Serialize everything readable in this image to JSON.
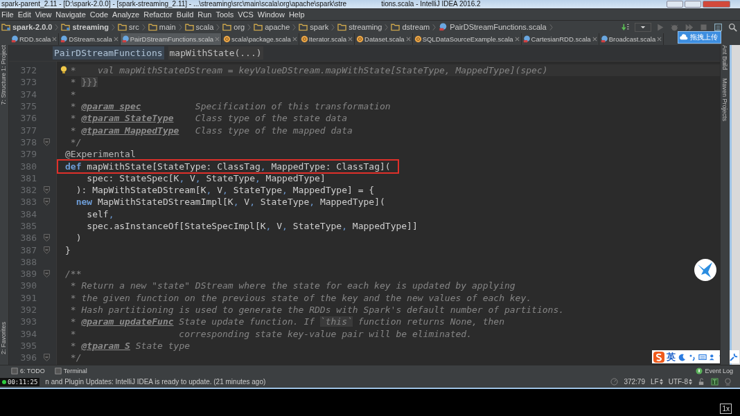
{
  "window": {
    "title_left": "spark-parent_2.11 - [D:\\spark-2.0.0] - [spark-streaming_2.11] - ...\\streaming\\src\\main\\scala\\org\\apache\\spark\\stre",
    "title_right": "tions.scala - IntelliJ IDEA 2016.2"
  },
  "menu": [
    "File",
    "Edit",
    "View",
    "Navigate",
    "Code",
    "Analyze",
    "Refactor",
    "Build",
    "Run",
    "Tools",
    "VCS",
    "Window",
    "Help"
  ],
  "breadcrumbs": [
    {
      "label": "spark-2.0.0",
      "kind": "module"
    },
    {
      "label": "streaming",
      "kind": "module"
    },
    {
      "label": "src",
      "kind": "folder"
    },
    {
      "label": "main",
      "kind": "folder"
    },
    {
      "label": "scala",
      "kind": "folder"
    },
    {
      "label": "org",
      "kind": "folder"
    },
    {
      "label": "apache",
      "kind": "folder"
    },
    {
      "label": "spark",
      "kind": "folder"
    },
    {
      "label": "streaming",
      "kind": "folder"
    },
    {
      "label": "dstream",
      "kind": "folder"
    },
    {
      "label": "PairDStreamFunctions.scala",
      "kind": "file"
    }
  ],
  "tabs": [
    {
      "label": "RDD.scala",
      "kind": "class",
      "selected": false
    },
    {
      "label": "DStream.scala",
      "kind": "class",
      "selected": false
    },
    {
      "label": "PairDStreamFunctions.scala",
      "kind": "class",
      "selected": true
    },
    {
      "label": "scala\\package.scala",
      "kind": "object",
      "selected": false
    },
    {
      "label": "Iterator.scala",
      "kind": "object",
      "selected": false
    },
    {
      "label": "Dataset.scala",
      "kind": "object",
      "selected": false
    },
    {
      "label": "SQLDataSourceExample.scala",
      "kind": "object",
      "selected": false
    },
    {
      "label": "CartesianRDD.scala",
      "kind": "class",
      "selected": false
    },
    {
      "label": "Broadcast.scala",
      "kind": "class",
      "selected": false
    }
  ],
  "editor_header": {
    "class_name": "PairDStreamFunctions",
    "method": "mapWithState(...)"
  },
  "lines": [
    {
      "number": "372",
      "fold": false,
      "current": true,
      "bulb": true,
      "boxed": false,
      "tokens": [
        {
          "kind": "comment",
          "text": " *    val mapWithStateDStream = keyValueDStream.mapWithState[StateType, MappedType](spec)"
        }
      ]
    },
    {
      "number": "373",
      "fold": false,
      "current": false,
      "bulb": false,
      "boxed": false,
      "tokens": [
        {
          "kind": "comment",
          "text": " * "
        },
        {
          "kind": "match",
          "text": "}}}"
        }
      ]
    },
    {
      "number": "374",
      "fold": false,
      "current": false,
      "bulb": false,
      "boxed": false,
      "tokens": [
        {
          "kind": "comment",
          "text": " *"
        }
      ]
    },
    {
      "number": "375",
      "fold": false,
      "current": false,
      "bulb": false,
      "boxed": false,
      "tokens": [
        {
          "kind": "comment",
          "text": " * "
        },
        {
          "kind": "tag",
          "text": "@param spec"
        },
        {
          "kind": "comment",
          "text": "          Specification of this transformation"
        }
      ]
    },
    {
      "number": "376",
      "fold": false,
      "current": false,
      "bulb": false,
      "boxed": false,
      "tokens": [
        {
          "kind": "comment",
          "text": " * "
        },
        {
          "kind": "tag",
          "text": "@tparam StateType"
        },
        {
          "kind": "comment",
          "text": "    Class type of the state data"
        }
      ]
    },
    {
      "number": "377",
      "fold": false,
      "current": false,
      "bulb": false,
      "boxed": false,
      "tokens": [
        {
          "kind": "comment",
          "text": " * "
        },
        {
          "kind": "tag",
          "text": "@tparam MappedType"
        },
        {
          "kind": "comment",
          "text": "   Class type of the mapped data"
        }
      ]
    },
    {
      "number": "378",
      "fold": true,
      "current": false,
      "bulb": false,
      "boxed": false,
      "tokens": [
        {
          "kind": "comment",
          "text": " */"
        }
      ]
    },
    {
      "number": "379",
      "fold": false,
      "current": false,
      "bulb": false,
      "boxed": false,
      "tokens": [
        {
          "kind": "annotation",
          "text": "@Experimental"
        }
      ]
    },
    {
      "number": "380",
      "fold": false,
      "current": false,
      "bulb": false,
      "boxed": true,
      "tokens": [
        {
          "kind": "keyword",
          "text": "def"
        },
        {
          "kind": "plain",
          "text": " mapWithState[StateType: ClassTag"
        },
        {
          "kind": "punct",
          "text": ","
        },
        {
          "kind": "plain",
          "text": " MappedType: ClassTag]("
        }
      ]
    },
    {
      "number": "381",
      "fold": false,
      "current": false,
      "bulb": false,
      "boxed": false,
      "tokens": [
        {
          "kind": "plain",
          "text": "    spec: StateSpec[K"
        },
        {
          "kind": "punct",
          "text": ","
        },
        {
          "kind": "plain",
          "text": " V"
        },
        {
          "kind": "punct",
          "text": ","
        },
        {
          "kind": "plain",
          "text": " StateType"
        },
        {
          "kind": "punct",
          "text": ","
        },
        {
          "kind": "plain",
          "text": " MappedType]"
        }
      ]
    },
    {
      "number": "382",
      "fold": true,
      "current": false,
      "bulb": false,
      "boxed": false,
      "tokens": [
        {
          "kind": "plain",
          "text": "  ): MapWithStateDStream[K"
        },
        {
          "kind": "punct",
          "text": ","
        },
        {
          "kind": "plain",
          "text": " V"
        },
        {
          "kind": "punct",
          "text": ","
        },
        {
          "kind": "plain",
          "text": " StateType"
        },
        {
          "kind": "punct",
          "text": ","
        },
        {
          "kind": "plain",
          "text": " MappedType] = {"
        }
      ]
    },
    {
      "number": "383",
      "fold": true,
      "current": false,
      "bulb": false,
      "boxed": false,
      "tokens": [
        {
          "kind": "keyword",
          "text": "  new"
        },
        {
          "kind": "plain",
          "text": " MapWithStateDStreamImpl[K"
        },
        {
          "kind": "punct",
          "text": ","
        },
        {
          "kind": "plain",
          "text": " V"
        },
        {
          "kind": "punct",
          "text": ","
        },
        {
          "kind": "plain",
          "text": " StateType"
        },
        {
          "kind": "punct",
          "text": ","
        },
        {
          "kind": "plain",
          "text": " MappedType]("
        }
      ]
    },
    {
      "number": "384",
      "fold": false,
      "current": false,
      "bulb": false,
      "boxed": false,
      "tokens": [
        {
          "kind": "plain",
          "text": "    self"
        },
        {
          "kind": "punct",
          "text": ","
        }
      ]
    },
    {
      "number": "385",
      "fold": false,
      "current": false,
      "bulb": false,
      "boxed": false,
      "tokens": [
        {
          "kind": "plain",
          "text": "    spec.asInstanceOf[StateSpecImpl[K"
        },
        {
          "kind": "punct",
          "text": ","
        },
        {
          "kind": "plain",
          "text": " V"
        },
        {
          "kind": "punct",
          "text": ","
        },
        {
          "kind": "plain",
          "text": " StateType"
        },
        {
          "kind": "punct",
          "text": ","
        },
        {
          "kind": "plain",
          "text": " MappedType]]"
        }
      ]
    },
    {
      "number": "386",
      "fold": true,
      "current": false,
      "bulb": false,
      "boxed": false,
      "tokens": [
        {
          "kind": "plain",
          "text": "  )"
        }
      ]
    },
    {
      "number": "387",
      "fold": true,
      "current": false,
      "bulb": false,
      "boxed": false,
      "tokens": [
        {
          "kind": "plain",
          "text": "}"
        }
      ]
    },
    {
      "number": "388",
      "fold": false,
      "bulb": false
    },
    {
      "number": "389",
      "fold": true,
      "current": false,
      "bulb": false,
      "boxed": false,
      "tokens": [
        {
          "kind": "comment",
          "text": "/**"
        }
      ]
    },
    {
      "number": "390",
      "fold": false,
      "current": false,
      "bulb": false,
      "boxed": false,
      "tokens": [
        {
          "kind": "comment",
          "text": " * Return a new \"state\" DStream where the state for each key is updated by applying"
        }
      ]
    },
    {
      "number": "391",
      "fold": false,
      "current": false,
      "bulb": false,
      "boxed": false,
      "tokens": [
        {
          "kind": "comment",
          "text": " * the given function on the previous state of the key and the new values of each key."
        }
      ]
    },
    {
      "number": "392",
      "fold": false,
      "current": false,
      "bulb": false,
      "boxed": false,
      "tokens": [
        {
          "kind": "comment",
          "text": " * Hash partitioning is used to generate the RDDs with Spark's default number of partitions."
        }
      ]
    },
    {
      "number": "393",
      "fold": false,
      "current": false,
      "bulb": false,
      "boxed": false,
      "tokens": [
        {
          "kind": "comment",
          "text": " * "
        },
        {
          "kind": "tag",
          "text": "@param updateFunc"
        },
        {
          "kind": "comment",
          "text": " State update function. If "
        },
        {
          "kind": "inline",
          "text": "`this`"
        },
        {
          "kind": "comment",
          "text": " function returns None, then"
        }
      ]
    },
    {
      "number": "394",
      "fold": false,
      "current": false,
      "bulb": false,
      "boxed": false,
      "tokens": [
        {
          "kind": "comment",
          "text": " *                   corresponding state key-value pair will be eliminated."
        }
      ]
    },
    {
      "number": "395",
      "fold": false,
      "current": false,
      "bulb": false,
      "boxed": false,
      "tokens": [
        {
          "kind": "comment",
          "text": " * "
        },
        {
          "kind": "tag",
          "text": "@tparam S"
        },
        {
          "kind": "comment",
          "text": " State type"
        }
      ]
    },
    {
      "number": "396",
      "fold": true,
      "current": false,
      "bulb": false,
      "boxed": false,
      "tokens": [
        {
          "kind": "comment",
          "text": " */"
        }
      ]
    }
  ],
  "side_left": [
    "1: Project",
    "7: Structure",
    "2: Favorites"
  ],
  "side_right": [
    "Ant Build",
    "Maven Projects"
  ],
  "tool_windows": [
    "6: TODO",
    "Terminal"
  ],
  "event_log": "Event Log",
  "status": {
    "timer": "00:11:25",
    "message": "n and Plugin Updates: IntelliJ IDEA is ready to update. (21 minutes ago)",
    "position": "372:79",
    "line_separator": "LF",
    "encoding": "UTF-8"
  },
  "upload_popup": "拖拽上传",
  "ime": "英",
  "playback_speed": "1x"
}
